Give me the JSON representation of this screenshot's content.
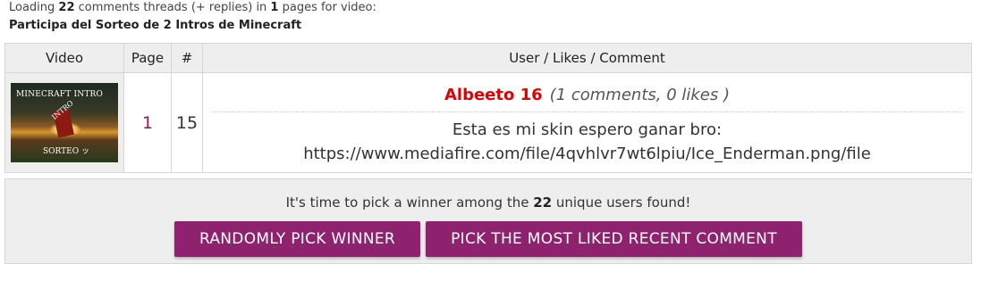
{
  "status": {
    "prefix": "Loading ",
    "threads_count": "22",
    "middle": " comments threads (+ replies) in ",
    "pages_count": "1",
    "suffix": " pages for video:"
  },
  "video_title": "Participa del Sorteo de 2 Intros de Minecraft",
  "table": {
    "headers": {
      "video": "Video",
      "page": "Page",
      "num": "#",
      "comment": "User / Likes / Comment"
    },
    "thumbnail": {
      "line1": "MINECRAFT INTRO",
      "line2": "INTRO",
      "line3": "SORTEO ッ"
    },
    "row": {
      "page": "1",
      "num": "15",
      "user": "Albeeto 16",
      "stats": "(1 comments, 0 likes )",
      "comment_line1": "Esta es mi skin espero ganar bro:",
      "comment_line2": "https://www.mediafire.com/file/4qvhlvr7wt6lpiu/Ice_Enderman.png/file"
    }
  },
  "winner_panel": {
    "msg_prefix": "It's time to pick a winner among the ",
    "unique_users": "22",
    "msg_suffix": " unique users found!",
    "random_button": "RANDOMLY PICK WINNER",
    "liked_button": "PICK THE MOST LIKED RECENT COMMENT"
  },
  "colors": {
    "button_bg": "#8e226f",
    "username": "#e00000",
    "header_bg": "#eeeeee"
  }
}
